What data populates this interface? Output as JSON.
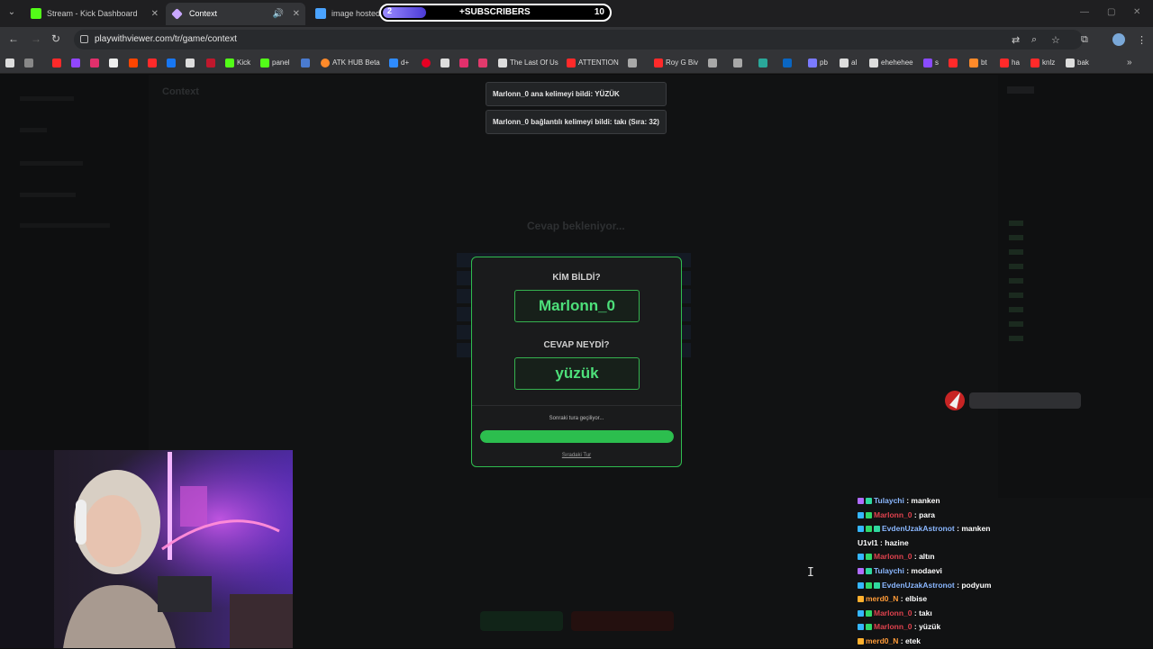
{
  "browser": {
    "tabs": [
      {
        "title": "Stream - Kick Dashboard",
        "favicon_color": "#53fc18"
      },
      {
        "title": "Context",
        "favicon_color": "#c9a7ff"
      },
      {
        "title": "image hosted a",
        "favicon_color": "#4aa3ff"
      }
    ],
    "subscribers": {
      "label": "SUBSCRIBERS",
      "count": "10",
      "goal_progress": "2"
    },
    "url": "playwithviewer.com/tr/game/context",
    "bookmarks": [
      {
        "label": "Kick",
        "color": "#53fc18"
      },
      {
        "label": "panel",
        "color": "#53fc18"
      },
      {
        "label": "ATK HUB Beta",
        "color": "#ff8a2a"
      },
      {
        "label": "d+",
        "color": "#2f8cff"
      },
      {
        "label": "The Last Of Us",
        "color": "#bbb"
      },
      {
        "label": "ATTENTION",
        "color": "#ff2a2a"
      },
      {
        "label": "Roy G Biv",
        "color": "#ff2a2a"
      },
      {
        "label": "pb",
        "color": "#7a7aff"
      },
      {
        "label": "al",
        "color": "#ddd"
      },
      {
        "label": "ehehehee",
        "color": "#ddd"
      },
      {
        "label": "s",
        "color": "#8a4bff"
      },
      {
        "label": "bt",
        "color": "#ff8a2a"
      },
      {
        "label": "ha",
        "color": "#ff2a2a"
      },
      {
        "label": "knlz",
        "color": "#ff2a2a"
      },
      {
        "label": "bak",
        "color": "#ddd"
      }
    ]
  },
  "game": {
    "page_title": "Context",
    "status": "Cevap bekleniyor..."
  },
  "toasts": [
    "Marlonn_0 ana kelimeyi bildi: YÜZÜK",
    "Marlonn_0 bağlantılı kelimeyi bildi: takı (Sıra: 32)"
  ],
  "modal": {
    "who_heading": "KİM BİLDİ?",
    "who_value": "Marlonn_0",
    "answer_heading": "CEVAP NEYDİ?",
    "answer_value": "yüzük",
    "next_text": "Sonraki tura geçiliyor...",
    "progress": 1.0,
    "link_text": "Sıradaki Tur"
  },
  "colors": {
    "accent": "#2cbe4e",
    "answer_text": "#4de07a"
  },
  "chat": [
    {
      "user": "Tulaychi",
      "color": "#8ab7ff",
      "text": "manken",
      "badges": [
        "#b06cff",
        "#2fd9a0"
      ]
    },
    {
      "user": "Marlonn_0",
      "color": "#e0424e",
      "text": "para",
      "badges": [
        "#35b6ff",
        "#2fd96b"
      ]
    },
    {
      "user": "EvdenUzakAstronot",
      "color": "#8ab7ff",
      "text": "manken",
      "badges": [
        "#35b6ff",
        "#2fd96b",
        "#2fd9a0"
      ]
    },
    {
      "user": "U1vl1",
      "color": "#ffffff",
      "text": "hazine",
      "badges": []
    },
    {
      "user": "Marlonn_0",
      "color": "#e0424e",
      "text": "altın",
      "badges": [
        "#35b6ff",
        "#2fd96b"
      ]
    },
    {
      "user": "Tulaychi",
      "color": "#8ab7ff",
      "text": "modaevi",
      "badges": [
        "#b06cff",
        "#2fd9a0"
      ]
    },
    {
      "user": "EvdenUzakAstronot",
      "color": "#8ab7ff",
      "text": "podyum",
      "badges": [
        "#35b6ff",
        "#2fd96b",
        "#2fd9a0"
      ]
    },
    {
      "user": "merd0_N",
      "color": "#ff9b38",
      "text": "elbise",
      "badges": [
        "#ffb02e"
      ]
    },
    {
      "user": "Marlonn_0",
      "color": "#e0424e",
      "text": "takı",
      "badges": [
        "#35b6ff",
        "#2fd96b"
      ]
    },
    {
      "user": "Marlonn_0",
      "color": "#e0424e",
      "text": "yüzük",
      "badges": [
        "#35b6ff",
        "#2fd96b"
      ]
    },
    {
      "user": "merd0_N",
      "color": "#ff9b38",
      "text": "etek",
      "badges": [
        "#ffb02e"
      ]
    }
  ]
}
